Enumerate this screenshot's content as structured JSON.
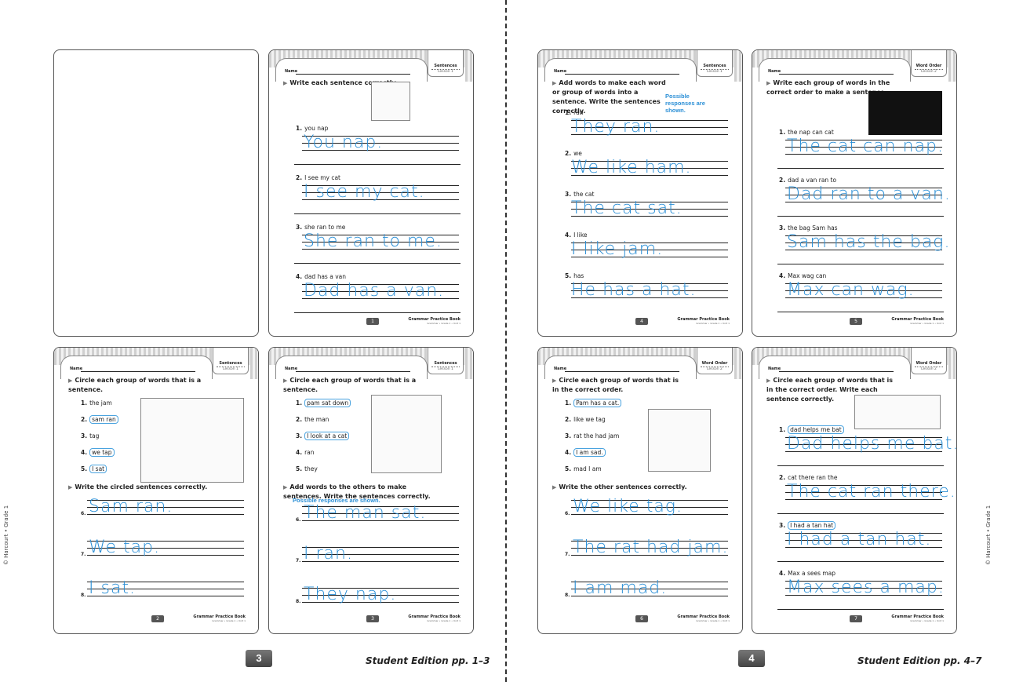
{
  "credits": {
    "left": "© Harcourt • Grade 1",
    "right": "© Harcourt • Grade 1"
  },
  "spread": [
    {
      "badge": "3",
      "edition": "Student Edition pp. 1–3"
    },
    {
      "badge": "4",
      "edition": "Student Edition pp. 4–7"
    }
  ],
  "common": {
    "name_label": "Name",
    "book": "Grammar Practice Book",
    "book_sub": "Grammar • Grade 1 • Unit 1"
  },
  "pages": {
    "p1": {
      "tab_title": "Sentences",
      "tab_lesson": "Lesson 1",
      "page_number": "1",
      "instruction": "Write each sentence correctly.",
      "items": [
        {
          "num": "1.",
          "prompt": "you nap",
          "answer": "You nap."
        },
        {
          "num": "2.",
          "prompt": "I see my cat",
          "answer": "I see my cat."
        },
        {
          "num": "3.",
          "prompt": "she ran to me",
          "answer": "She ran to me."
        },
        {
          "num": "4.",
          "prompt": "dad has a van",
          "answer": "Dad has a van."
        }
      ]
    },
    "p2": {
      "tab_title": "Sentences",
      "tab_lesson": "Lesson 1",
      "page_number": "2",
      "instruction": "Circle each group of words that is a sentence.",
      "items": [
        {
          "num": "1.",
          "prompt": "the jam",
          "circled": false
        },
        {
          "num": "2.",
          "prompt": "sam ran",
          "circled": true
        },
        {
          "num": "3.",
          "prompt": "tag",
          "circled": false
        },
        {
          "num": "4.",
          "prompt": "we tap",
          "circled": true
        },
        {
          "num": "5.",
          "prompt": "I sat",
          "circled": true
        }
      ],
      "instruction2": "Write the circled sentences correctly.",
      "answers": [
        {
          "num": "6.",
          "answer": "Sam ran."
        },
        {
          "num": "7.",
          "answer": "We tap."
        },
        {
          "num": "8.",
          "answer": "I sat."
        }
      ]
    },
    "p3": {
      "tab_title": "Sentences",
      "tab_lesson": "Lesson 1",
      "page_number": "3",
      "instruction": "Circle each group of words that is a sentence.",
      "items": [
        {
          "num": "1.",
          "prompt": "pam sat down",
          "circled": true
        },
        {
          "num": "2.",
          "prompt": "the man",
          "circled": false
        },
        {
          "num": "3.",
          "prompt": "I look at a cat",
          "circled": true
        },
        {
          "num": "4.",
          "prompt": "ran",
          "circled": false
        },
        {
          "num": "5.",
          "prompt": "they",
          "circled": false
        }
      ],
      "instruction2": "Add words to the others to make sentences. Write the sentences correctly.",
      "possible": "Possible responses are shown.",
      "answers": [
        {
          "num": "6.",
          "answer": "The man sat."
        },
        {
          "num": "7.",
          "answer": "I ran."
        },
        {
          "num": "8.",
          "answer": "They nap."
        }
      ]
    },
    "p4": {
      "tab_title": "Sentences",
      "tab_lesson": "Lesson 1",
      "page_number": "4",
      "instruction": "Add words to make each word or group of words into a sentence. Write the sentences correctly.",
      "possible": "Possible responses are shown.",
      "items": [
        {
          "num": "1.",
          "prompt": "ran",
          "answer": "They ran."
        },
        {
          "num": "2.",
          "prompt": "we",
          "answer": "We like ham."
        },
        {
          "num": "3.",
          "prompt": "the cat",
          "answer": "The cat sat."
        },
        {
          "num": "4.",
          "prompt": "I like",
          "answer": "I like jam."
        },
        {
          "num": "5.",
          "prompt": "has",
          "answer": "He has a hat."
        }
      ]
    },
    "p5": {
      "tab_title": "Word Order",
      "tab_lesson": "Lesson 2",
      "page_number": "5",
      "instruction": "Write each group of words in the correct order to make a sentence.",
      "items": [
        {
          "num": "1.",
          "prompt": "the nap can cat",
          "answer": "The cat can nap."
        },
        {
          "num": "2.",
          "prompt": "dad a van ran to",
          "answer": "Dad ran to a van."
        },
        {
          "num": "3.",
          "prompt": "the bag Sam has",
          "answer": "Sam has the bag."
        },
        {
          "num": "4.",
          "prompt": "Max wag can",
          "answer": "Max can wag."
        }
      ]
    },
    "p6": {
      "tab_title": "Word Order",
      "tab_lesson": "Lesson 2",
      "page_number": "6",
      "instruction": "Circle each group of words that is in the correct order.",
      "items": [
        {
          "num": "1.",
          "prompt": "Pam has a cat.",
          "circled": true
        },
        {
          "num": "2.",
          "prompt": "like we tag",
          "circled": false
        },
        {
          "num": "3.",
          "prompt": "rat the had jam",
          "circled": false
        },
        {
          "num": "4.",
          "prompt": "I am sad.",
          "circled": true
        },
        {
          "num": "5.",
          "prompt": "mad I am",
          "circled": false
        }
      ],
      "instruction2": "Write the other sentences correctly.",
      "answers": [
        {
          "num": "6.",
          "answer": "We like tag."
        },
        {
          "num": "7.",
          "answer": "The rat had jam."
        },
        {
          "num": "8.",
          "answer": "I am mad."
        }
      ]
    },
    "p7": {
      "tab_title": "Word Order",
      "tab_lesson": "Lesson 2",
      "page_number": "7",
      "instruction": "Circle each group of words that is in the correct order. Write each sentence correctly.",
      "items": [
        {
          "num": "1.",
          "prompt": "dad helps me bat",
          "circled": true,
          "answer": "Dad helps me bat."
        },
        {
          "num": "2.",
          "prompt": "cat there ran the",
          "circled": false,
          "answer": "The cat ran there."
        },
        {
          "num": "3.",
          "prompt": "I had a tan hat",
          "circled": true,
          "answer": "I had a tan hat."
        },
        {
          "num": "4.",
          "prompt": "Max a sees map",
          "circled": false,
          "answer": "Max sees a map."
        }
      ]
    }
  }
}
